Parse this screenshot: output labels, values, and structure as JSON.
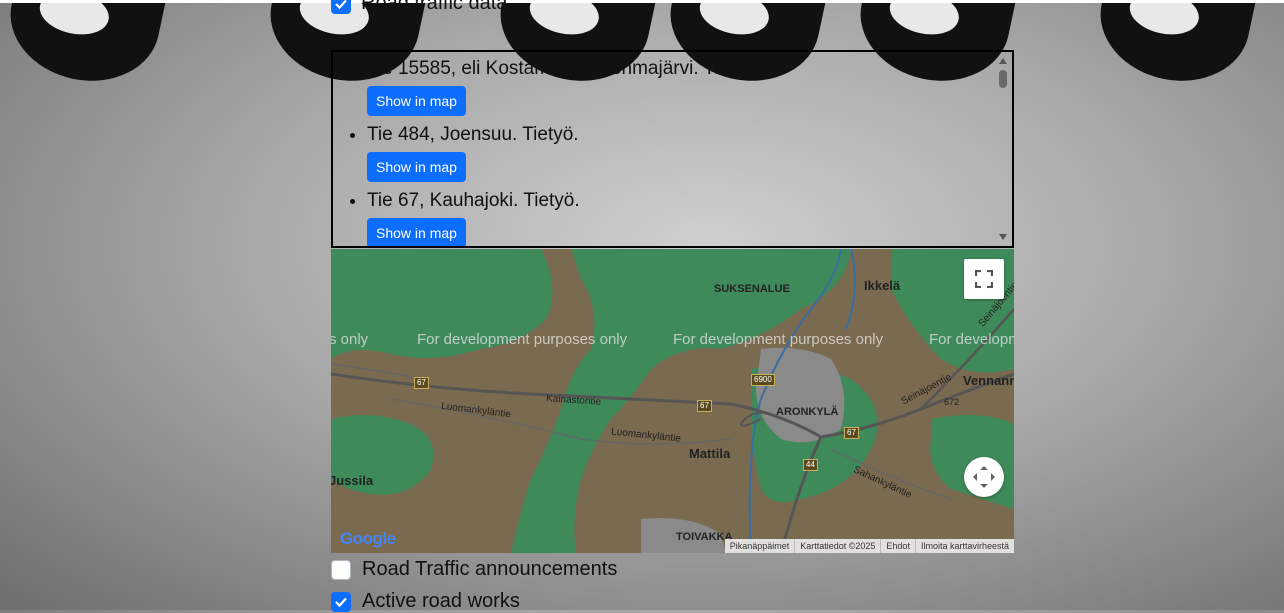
{
  "options": {
    "road_traffic_data": "Road traffic data",
    "road_traffic_announcements": "Road Traffic announcements",
    "active_road_works": "Active road works"
  },
  "announcements": [
    {
      "text": "Tie 15585, eli Kostamontie, Tohmajärvi. Tietyö.",
      "button": "Show in map"
    },
    {
      "text": "Tie 484, Joensuu. Tietyö.",
      "button": "Show in map"
    },
    {
      "text": "Tie 67, Kauhajoki. Tietyö.",
      "button": "Show in map"
    }
  ],
  "map": {
    "watermark": "For development purposes only",
    "watermark_start": "s only",
    "watermark_end": "For developm",
    "places": {
      "suksenalue": "SUKSENALUE",
      "ikkela": "Ikkelä",
      "vennann": "Vennann",
      "aronkyla": "ARONKYLÄ",
      "mattila": "Mattila",
      "jussila": "Jussila",
      "toivakka": "TOIVAKKA"
    },
    "roads": {
      "kainastontie": "Kainastontie",
      "luomankylantie1": "Luomankyläntie",
      "luomankylantie2": "Luomankyläntie",
      "seinajoentie1": "Seinäjoentie",
      "seinajoentie2": "Seinäjoentie",
      "sahankylantie": "Sahankyläntie"
    },
    "shields": {
      "r67a": "67",
      "r67b": "67",
      "r67c": "67",
      "r6900": "6900",
      "r672": "672",
      "r44": "44"
    },
    "logo": "Google",
    "attribution": [
      "Pikanäppäimet",
      "Karttatiedot ©2025",
      "Ehdot",
      "Ilmoita karttavirheestä"
    ]
  },
  "colors": {
    "button_blue": "#0d6efd",
    "map_green": "#3f8a5a",
    "map_land": "#7a6a50"
  }
}
